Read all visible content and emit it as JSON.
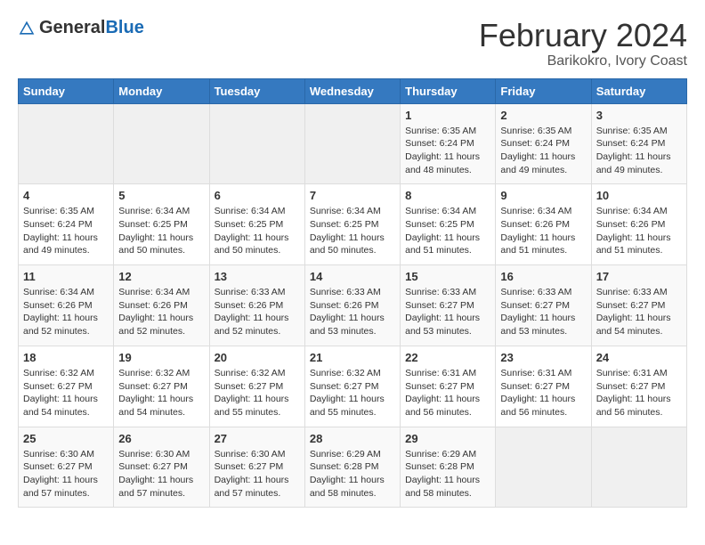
{
  "header": {
    "logo_general": "General",
    "logo_blue": "Blue",
    "title": "February 2024",
    "subtitle": "Barikokro, Ivory Coast"
  },
  "calendar": {
    "days_of_week": [
      "Sunday",
      "Monday",
      "Tuesday",
      "Wednesday",
      "Thursday",
      "Friday",
      "Saturday"
    ],
    "weeks": [
      [
        {
          "day": "",
          "details": ""
        },
        {
          "day": "",
          "details": ""
        },
        {
          "day": "",
          "details": ""
        },
        {
          "day": "",
          "details": ""
        },
        {
          "day": "1",
          "details": "Sunrise: 6:35 AM\nSunset: 6:24 PM\nDaylight: 11 hours\nand 48 minutes."
        },
        {
          "day": "2",
          "details": "Sunrise: 6:35 AM\nSunset: 6:24 PM\nDaylight: 11 hours\nand 49 minutes."
        },
        {
          "day": "3",
          "details": "Sunrise: 6:35 AM\nSunset: 6:24 PM\nDaylight: 11 hours\nand 49 minutes."
        }
      ],
      [
        {
          "day": "4",
          "details": "Sunrise: 6:35 AM\nSunset: 6:24 PM\nDaylight: 11 hours\nand 49 minutes."
        },
        {
          "day": "5",
          "details": "Sunrise: 6:34 AM\nSunset: 6:25 PM\nDaylight: 11 hours\nand 50 minutes."
        },
        {
          "day": "6",
          "details": "Sunrise: 6:34 AM\nSunset: 6:25 PM\nDaylight: 11 hours\nand 50 minutes."
        },
        {
          "day": "7",
          "details": "Sunrise: 6:34 AM\nSunset: 6:25 PM\nDaylight: 11 hours\nand 50 minutes."
        },
        {
          "day": "8",
          "details": "Sunrise: 6:34 AM\nSunset: 6:25 PM\nDaylight: 11 hours\nand 51 minutes."
        },
        {
          "day": "9",
          "details": "Sunrise: 6:34 AM\nSunset: 6:26 PM\nDaylight: 11 hours\nand 51 minutes."
        },
        {
          "day": "10",
          "details": "Sunrise: 6:34 AM\nSunset: 6:26 PM\nDaylight: 11 hours\nand 51 minutes."
        }
      ],
      [
        {
          "day": "11",
          "details": "Sunrise: 6:34 AM\nSunset: 6:26 PM\nDaylight: 11 hours\nand 52 minutes."
        },
        {
          "day": "12",
          "details": "Sunrise: 6:34 AM\nSunset: 6:26 PM\nDaylight: 11 hours\nand 52 minutes."
        },
        {
          "day": "13",
          "details": "Sunrise: 6:33 AM\nSunset: 6:26 PM\nDaylight: 11 hours\nand 52 minutes."
        },
        {
          "day": "14",
          "details": "Sunrise: 6:33 AM\nSunset: 6:26 PM\nDaylight: 11 hours\nand 53 minutes."
        },
        {
          "day": "15",
          "details": "Sunrise: 6:33 AM\nSunset: 6:27 PM\nDaylight: 11 hours\nand 53 minutes."
        },
        {
          "day": "16",
          "details": "Sunrise: 6:33 AM\nSunset: 6:27 PM\nDaylight: 11 hours\nand 53 minutes."
        },
        {
          "day": "17",
          "details": "Sunrise: 6:33 AM\nSunset: 6:27 PM\nDaylight: 11 hours\nand 54 minutes."
        }
      ],
      [
        {
          "day": "18",
          "details": "Sunrise: 6:32 AM\nSunset: 6:27 PM\nDaylight: 11 hours\nand 54 minutes."
        },
        {
          "day": "19",
          "details": "Sunrise: 6:32 AM\nSunset: 6:27 PM\nDaylight: 11 hours\nand 54 minutes."
        },
        {
          "day": "20",
          "details": "Sunrise: 6:32 AM\nSunset: 6:27 PM\nDaylight: 11 hours\nand 55 minutes."
        },
        {
          "day": "21",
          "details": "Sunrise: 6:32 AM\nSunset: 6:27 PM\nDaylight: 11 hours\nand 55 minutes."
        },
        {
          "day": "22",
          "details": "Sunrise: 6:31 AM\nSunset: 6:27 PM\nDaylight: 11 hours\nand 56 minutes."
        },
        {
          "day": "23",
          "details": "Sunrise: 6:31 AM\nSunset: 6:27 PM\nDaylight: 11 hours\nand 56 minutes."
        },
        {
          "day": "24",
          "details": "Sunrise: 6:31 AM\nSunset: 6:27 PM\nDaylight: 11 hours\nand 56 minutes."
        }
      ],
      [
        {
          "day": "25",
          "details": "Sunrise: 6:30 AM\nSunset: 6:27 PM\nDaylight: 11 hours\nand 57 minutes."
        },
        {
          "day": "26",
          "details": "Sunrise: 6:30 AM\nSunset: 6:27 PM\nDaylight: 11 hours\nand 57 minutes."
        },
        {
          "day": "27",
          "details": "Sunrise: 6:30 AM\nSunset: 6:27 PM\nDaylight: 11 hours\nand 57 minutes."
        },
        {
          "day": "28",
          "details": "Sunrise: 6:29 AM\nSunset: 6:28 PM\nDaylight: 11 hours\nand 58 minutes."
        },
        {
          "day": "29",
          "details": "Sunrise: 6:29 AM\nSunset: 6:28 PM\nDaylight: 11 hours\nand 58 minutes."
        },
        {
          "day": "",
          "details": ""
        },
        {
          "day": "",
          "details": ""
        }
      ]
    ]
  }
}
